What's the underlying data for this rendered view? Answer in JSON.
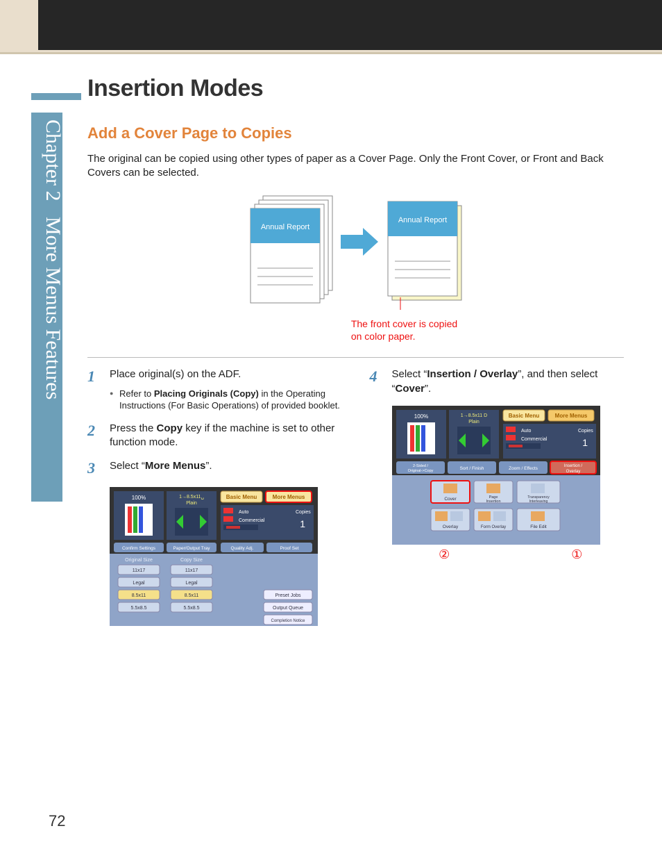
{
  "sideTab": {
    "chapter": "Chapter 2",
    "title": "More Menus Features"
  },
  "heading": "Insertion Modes",
  "subheading": "Add a Cover Page to Copies",
  "intro": "The original can be copied using other types of paper as a Cover Page. Only the Front Cover, or Front and Back Covers can be selected.",
  "diagram": {
    "coverText": "Annual Report",
    "caption1": "The front cover is copied",
    "caption2": "on color paper."
  },
  "steps": {
    "s1": {
      "text": "Place original(s) on the ADF.",
      "bullet_pre": "Refer to ",
      "bullet_bold": "Placing Originals (Copy)",
      "bullet_post": " in the Operating Instructions (For Basic Operations) of provided booklet."
    },
    "s2": {
      "pre": "Press the ",
      "bold": "Copy",
      "post": " key if the machine is set to other function mode."
    },
    "s3": {
      "pre": "Select “",
      "bold": "More Menus",
      "post": "”."
    },
    "s4": {
      "pre": "Select “",
      "bold1": "Insertion / Overlay",
      "mid": "”, and then select “",
      "bold2": "Cover",
      "post": "”."
    }
  },
  "screenshot1": {
    "zoom": "100%",
    "paper": "1→8.5x11␣",
    "plain": "Plain",
    "basicMenu": "Basic Menu",
    "moreMenus": "More Menus",
    "auto": "Auto",
    "commercial": "Commercial",
    "copies": "Copies",
    "copiesVal": "1",
    "confirm": "Confirm Settings",
    "paperTray": "Paper/Output Tray",
    "quality": "Quality Adj.",
    "proof": "Proof Set",
    "origSize": "Original Size",
    "copySize": "Copy Size",
    "sizes": [
      "11x17",
      "Legal",
      "8.5x11",
      "5.5x8.5"
    ],
    "preset": "Preset Jobs",
    "outputQueue": "Output Queue",
    "completion": "Completion Notice"
  },
  "screenshot2": {
    "zoom": "100%",
    "paper": "1→8.5x11 D",
    "plain": "Plain",
    "basicMenu": "Basic Menu",
    "moreMenus": "More Menus",
    "auto": "Auto",
    "commercial": "Commercial",
    "copies": "Copies",
    "copiesVal": "1",
    "tab1": "2-Sided / Original->Copy",
    "tab2": "Sort / Finish",
    "tab3": "Zoom / Effects",
    "tab4": "Insertion / Overlay",
    "row1": [
      "Cover",
      "Page Insertion",
      "Transparency Interleaving"
    ],
    "row2": [
      "Overlay",
      "Form Overlay",
      "File Edit"
    ]
  },
  "callouts": {
    "c2": "②",
    "c1": "①"
  },
  "pageNumber": "72"
}
